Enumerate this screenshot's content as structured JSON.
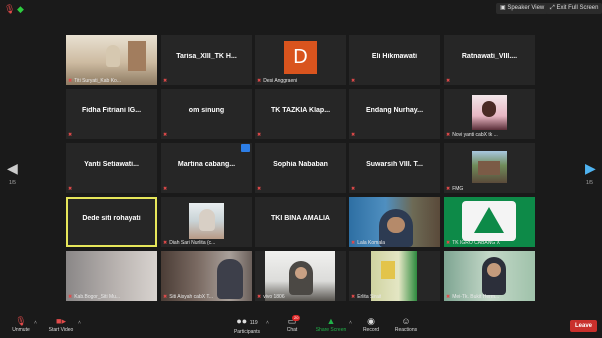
{
  "top": {
    "speaker_view": "Speaker View",
    "exit_full_screen": "Exit Full Screen"
  },
  "nav": {
    "page_left": "1/5",
    "page_right": "1/5"
  },
  "tiles": [
    {
      "name": "Titi Suryati_Kab Ko...",
      "center": ""
    },
    {
      "name": "",
      "center": "Tarisa_XIII_TK H..."
    },
    {
      "name": "Desi Anggraeni",
      "center": "",
      "letter": "D"
    },
    {
      "name": "",
      "center": "Eli Hikmawati"
    },
    {
      "name": "",
      "center": "Ratnawati_VIII...."
    },
    {
      "name": "",
      "center": "Fidha Fitriani IG..."
    },
    {
      "name": "",
      "center": "om sinung"
    },
    {
      "name": "",
      "center": "TK TAZKIA Klap..."
    },
    {
      "name": "",
      "center": "Endang Nurhay..."
    },
    {
      "name": "Novi yanti cabX tk ...",
      "center": ""
    },
    {
      "name": "",
      "center": "Yanti Setiawati..."
    },
    {
      "name": "",
      "center": "Martina cabang..."
    },
    {
      "name": "",
      "center": "Sophia Nababan"
    },
    {
      "name": "",
      "center": "Suwarsih VIII. T..."
    },
    {
      "name": "FMG",
      "center": ""
    },
    {
      "name": "",
      "center": "Dede siti rohayati"
    },
    {
      "name": "Diah Sari Nurlita (c...",
      "center": ""
    },
    {
      "name": "",
      "center": "TKI BINA AMALIA"
    },
    {
      "name": "Lala Komala",
      "center": ""
    },
    {
      "name": "TK IGRO CABANG X",
      "center": ""
    },
    {
      "name": "Kab.Bogor_Siti Mu...",
      "center": ""
    },
    {
      "name": "Siti Aisyah cabX T...",
      "center": ""
    },
    {
      "name": "vivo 1806",
      "center": ""
    },
    {
      "name": "Erlita Sirait",
      "center": ""
    },
    {
      "name": "Mei-Tk. Bukit Herm...",
      "center": ""
    }
  ],
  "bottom": {
    "unmute": "Unmute",
    "start_video": "Start Video",
    "participants": "Participants",
    "participants_count": "119",
    "chat": "Chat",
    "chat_badge": "20",
    "share_screen": "Share Screen",
    "record": "Record",
    "reactions": "Reactions",
    "leave": "Leave"
  },
  "colors": {
    "background": "#1a1a1a",
    "tile": "#262626",
    "active_border": "#e6e65a",
    "share": "#22b34a",
    "leave": "#c9302c"
  }
}
